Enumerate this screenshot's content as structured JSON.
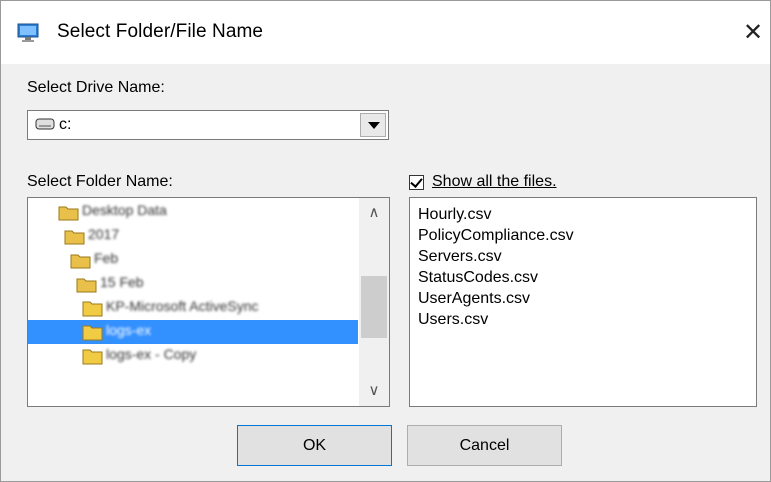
{
  "window": {
    "title": "Select Folder/File  Name",
    "close_glyph": "✕",
    "icon": "monitor-icon"
  },
  "drive": {
    "label": "Select Drive Name:",
    "value": "c:",
    "icon": "drive-icon"
  },
  "folders": {
    "label": "Select Folder Name:",
    "items": [
      {
        "name": "Desktop Data",
        "selected": false
      },
      {
        "name": "2017",
        "selected": false
      },
      {
        "name": "Feb",
        "selected": false
      },
      {
        "name": "15 Feb",
        "selected": false
      },
      {
        "name": "KP-Microsoft ActiveSync",
        "selected": false
      },
      {
        "name": "logs-ex",
        "selected": true
      },
      {
        "name": "logs-ex - Copy",
        "selected": false
      }
    ],
    "scroll_up": "∧",
    "scroll_down": "∨"
  },
  "show_all": {
    "label": "Show all the files.",
    "checked": true
  },
  "files": [
    "Hourly.csv",
    "PolicyCompliance.csv",
    "Servers.csv",
    "StatusCodes.csv",
    "UserAgents.csv",
    "Users.csv"
  ],
  "buttons": {
    "ok": "OK",
    "cancel": "Cancel"
  },
  "colors": {
    "selection": "#3390ff",
    "dialog_bg": "#f0f0f0",
    "folder_yellow": "#e8c04a"
  }
}
